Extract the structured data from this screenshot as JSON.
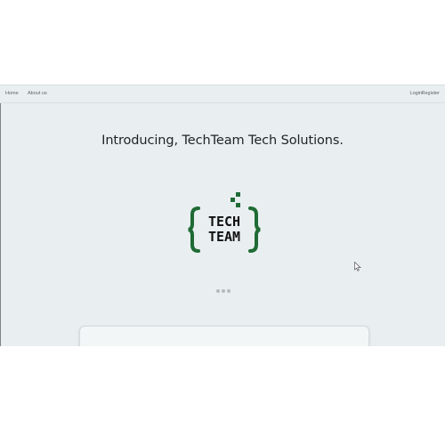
{
  "nav": {
    "home": "Home",
    "about": "About us",
    "login": "Login",
    "register": "Register"
  },
  "hero": {
    "headline": "Introducing, TechTeam Tech Solutions."
  },
  "logo": {
    "line1": "TECH",
    "line2": "TEAM",
    "color": "#1f6b35"
  },
  "carousel": {
    "dot_count": 3
  }
}
